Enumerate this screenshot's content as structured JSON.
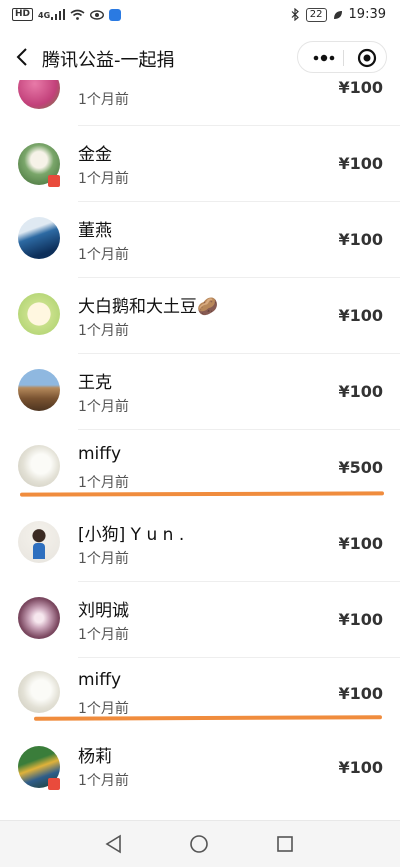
{
  "status": {
    "left_icons": [
      "hd-icon",
      "4g-signal-icon",
      "wifi-icon",
      "eye-icon",
      "app-notification-icon"
    ],
    "hd_label": "HD",
    "net_label": "4G",
    "battery": "22",
    "time": "19:39"
  },
  "header": {
    "title": "腾讯公益-一起捐",
    "back_icon": "chevron-left-icon"
  },
  "donors": [
    {
      "name": "",
      "time": "1个月前",
      "amount": "¥100"
    },
    {
      "name": "金金",
      "time": "1个月前",
      "amount": "¥100"
    },
    {
      "name": "董燕",
      "time": "1个月前",
      "amount": "¥100"
    },
    {
      "name": "大白鹅和大土豆🥔",
      "time": "1个月前",
      "amount": "¥100"
    },
    {
      "name": "王克",
      "time": "1个月前",
      "amount": "¥100"
    },
    {
      "name": "miffy",
      "time": "1个月前",
      "amount": "¥500"
    },
    {
      "name": "[小狗] Y u n .",
      "time": "1个月前",
      "amount": "¥100"
    },
    {
      "name": "刘明诚",
      "time": "1个月前",
      "amount": "¥100"
    },
    {
      "name": "miffy",
      "time": "1个月前",
      "amount": "¥100"
    },
    {
      "name": "杨莉",
      "time": "1个月前",
      "amount": "¥100"
    }
  ],
  "colors": {
    "underline_mark": "#f08c3d"
  },
  "system_nav": [
    "back-triangle-icon",
    "home-circle-icon",
    "recents-square-icon"
  ]
}
